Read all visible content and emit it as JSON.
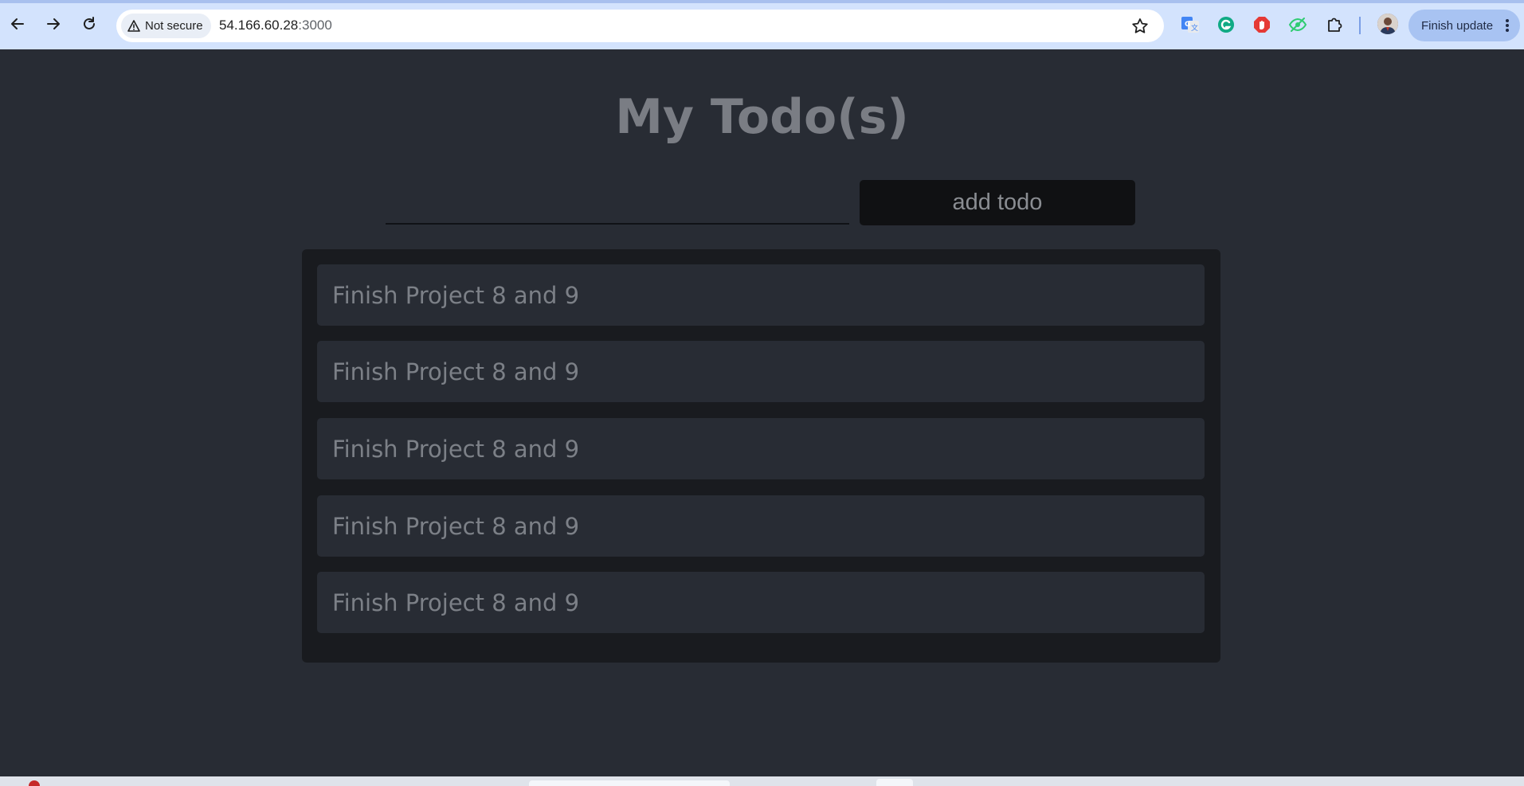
{
  "browser": {
    "security_label": "Not secure",
    "url_host": "54.166.60.28",
    "url_port": ":3000",
    "finish_update_label": "Finish update",
    "icons": [
      "back-arrow-icon",
      "forward-arrow-icon",
      "reload-icon",
      "warning-icon",
      "bookmark-star-icon",
      "google-translate-icon",
      "grammarly-icon",
      "adblock-icon",
      "eye-extension-icon",
      "extensions-puzzle-icon",
      "profile-avatar",
      "more-vert-icon"
    ]
  },
  "app": {
    "title": "My Todo(s)",
    "input_value": "",
    "add_button_label": "add todo",
    "todos": [
      {
        "text": "Finish Project 8 and 9"
      },
      {
        "text": "Finish Project 8 and 9"
      },
      {
        "text": "Finish Project 8 and 9"
      },
      {
        "text": "Finish Project 8 and 9"
      },
      {
        "text": "Finish Project 8 and 9"
      }
    ]
  },
  "colors": {
    "page_bg": "#282c34",
    "list_bg": "#191b1f",
    "button_bg": "#101113",
    "text_muted": "#7c8087",
    "chrome_bg": "#d3e3fd"
  }
}
